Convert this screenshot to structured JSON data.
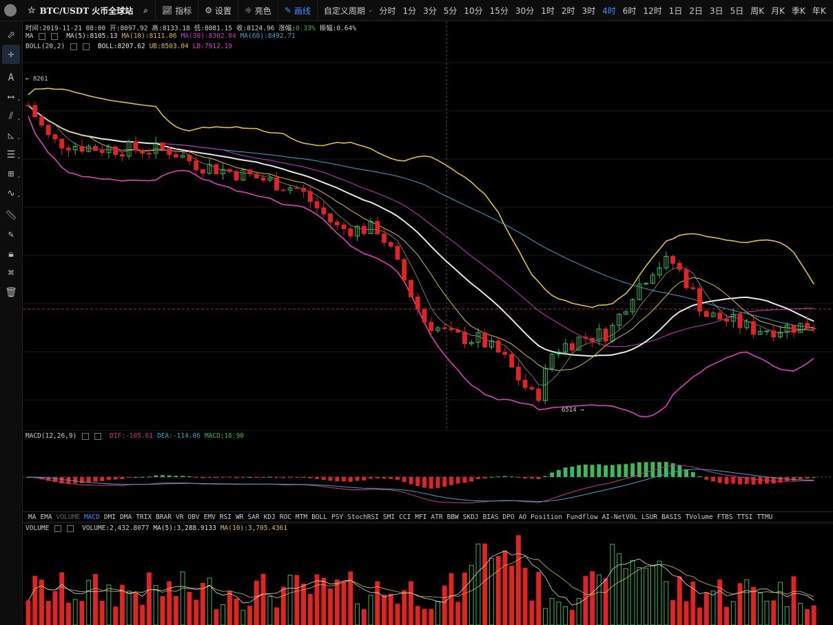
{
  "header": {
    "symbol": "BTC/USDT 火币全球站",
    "indicators_label": "指标",
    "settings_label": "设置",
    "theme_label": "亮色",
    "draw_label": "画线",
    "custom_period_label": "自定义周期",
    "periods": [
      "分时",
      "1分",
      "3分",
      "5分",
      "10分",
      "15分",
      "30分",
      "1时",
      "2时",
      "3时",
      "4时",
      "6时",
      "12时",
      "1日",
      "2日",
      "3日",
      "5日",
      "周K",
      "月K",
      "季K",
      "年K"
    ],
    "active_period": "4时"
  },
  "info": {
    "time": "时间:2019-11-21 08:00",
    "open": "开:8097.92",
    "high": "高:8133.18",
    "low": "低:8081.15",
    "close": "收:8124.96",
    "change_label": "涨幅:",
    "change_value": "0.33%",
    "amp": "振幅:0.64%"
  },
  "ma_line": {
    "name": "MA",
    "ma5": "MA(5):8105.13",
    "ma10": "MA(10):8111.06",
    "ma30": "MA(30):8302.04",
    "ma60": "MA(60):8492.71"
  },
  "boll_line": {
    "name": "BOLL(20,2)",
    "boll": "BOLL:8207.62",
    "ub": "UB:8503.04",
    "lb": "LB:7912.19"
  },
  "macd_line": {
    "name": "MACD(12,26,9)",
    "dif": "DIF:-105.61",
    "dea": "DEA:-114.06",
    "macd": "MACD:16.90"
  },
  "volume_line": {
    "name": "VOLUME",
    "volume": "VOLUME:2,432.8077",
    "ma5": "MA(5):3,288.9133",
    "ma10": "MA(10):3,705.4361"
  },
  "price_marks": {
    "high": "8261",
    "low": "6514"
  },
  "indicator_tabs": [
    "MA",
    "EMA",
    "VOLUME",
    "MACD",
    "DMI",
    "DMA",
    "TRIX",
    "BRAR",
    "VR",
    "OBV",
    "EMV",
    "RSI",
    "WR",
    "SAR",
    "KDJ",
    "ROC",
    "MTM",
    "BOLL",
    "PSY",
    "StochRSI",
    "SMI",
    "CCI",
    "MFI",
    "ATR",
    "BBW",
    "SKDJ",
    "BIAS",
    "DPO",
    "AO",
    "Position",
    "Fundflow",
    "AI-NetVOL",
    "LSUR",
    "BASIS",
    "TVolume",
    "FTBS",
    "TTSI",
    "TTMU"
  ],
  "active_tab": "MACD",
  "dim_tab": "VOLUME",
  "colors": {
    "up": "#3cb95c",
    "down": "#e02424",
    "ma5": "#e0e0e0",
    "ma10": "#d4c04a",
    "ma30": "#c83ac8",
    "ma60": "#3aa6c8",
    "boll_ub": "#e0c040",
    "boll_lb": "#e040c0",
    "boll_mid": "#e8e8e8",
    "active": "#4a8cff"
  },
  "tools": [
    "cursor-icon",
    "crosshair-icon",
    "text-icon",
    "line-icon",
    "multi-line-icon",
    "triangle-icon",
    "parallel-icon",
    "grid-icon",
    "wave-icon",
    "ruler-icon",
    "pencil-icon",
    "lock-icon",
    "eye-icon",
    "trash-icon"
  ]
}
